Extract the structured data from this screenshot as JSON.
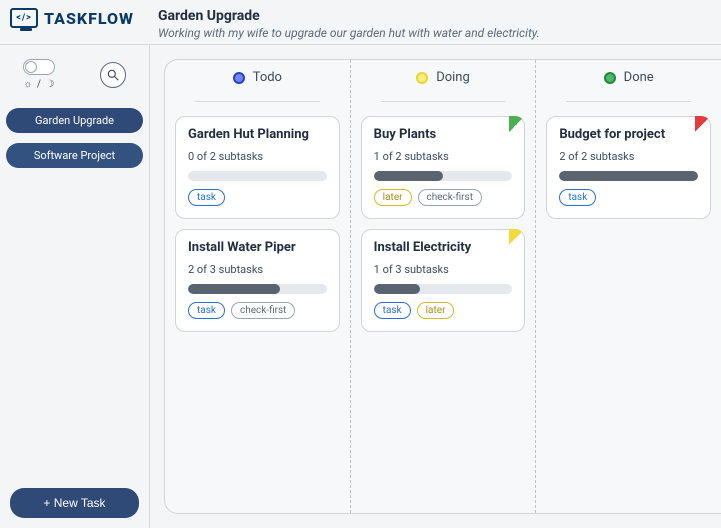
{
  "brand": "TASKFLOW",
  "header": {
    "title": "Garden Upgrade",
    "subtitle": "Working with my wife to upgrade our garden hut with water and electricity."
  },
  "sidebar": {
    "theme_label": "☼ / ☽",
    "projects": [
      {
        "label": "Garden Upgrade"
      },
      {
        "label": "Software Project"
      }
    ],
    "new_task_label": "+ New Task"
  },
  "columns": [
    {
      "key": "todo",
      "label": "Todo",
      "cards": [
        {
          "title": "Garden Hut Planning",
          "subtasks_done": 0,
          "subtasks_total": 2,
          "subtitle": "0 of 2 subtasks",
          "corner": "",
          "tags": [
            {
              "text": "task",
              "style": "blue"
            }
          ]
        },
        {
          "title": "Install Water Piper",
          "subtasks_done": 2,
          "subtasks_total": 3,
          "subtitle": "2 of 3 subtasks",
          "corner": "",
          "tags": [
            {
              "text": "task",
              "style": "blue"
            },
            {
              "text": "check-first",
              "style": "grey"
            }
          ]
        }
      ]
    },
    {
      "key": "doing",
      "label": "Doing",
      "cards": [
        {
          "title": "Buy Plants",
          "subtasks_done": 1,
          "subtasks_total": 2,
          "subtitle": "1 of 2 subtasks",
          "corner": "green",
          "tags": [
            {
              "text": "later",
              "style": "yellow"
            },
            {
              "text": "check-first",
              "style": "grey"
            }
          ]
        },
        {
          "title": "Install Electricity",
          "subtasks_done": 1,
          "subtasks_total": 3,
          "subtitle": "1 of 3 subtasks",
          "corner": "yellow",
          "tags": [
            {
              "text": "task",
              "style": "blue"
            },
            {
              "text": "later",
              "style": "yellow"
            }
          ]
        }
      ]
    },
    {
      "key": "done",
      "label": "Done",
      "cards": [
        {
          "title": "Budget for project",
          "subtasks_done": 2,
          "subtasks_total": 2,
          "subtitle": "2 of 2 subtasks",
          "corner": "red",
          "tags": [
            {
              "text": "task",
              "style": "blue"
            }
          ]
        }
      ]
    }
  ]
}
